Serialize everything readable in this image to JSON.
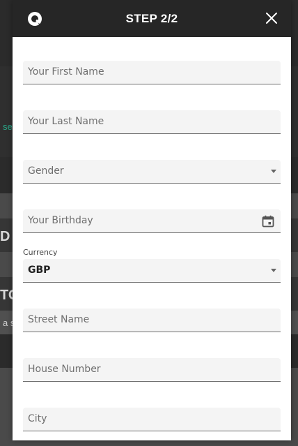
{
  "backdrop": {
    "link_text": "se",
    "heading_1": "D",
    "heading_2": "TO",
    "small_text": "a s"
  },
  "modal": {
    "title": "STEP 2/2",
    "brand_icon": "brand-logo-icon",
    "close_icon": "close-icon"
  },
  "form": {
    "first_name_placeholder": "Your First Name",
    "last_name_placeholder": "Your Last Name",
    "gender_placeholder": "Gender",
    "birthday_placeholder": "Your Birthday",
    "currency_label": "Currency",
    "currency_value": "GBP",
    "street_placeholder": "Street Name",
    "house_placeholder": "House Number",
    "city_placeholder": "City"
  },
  "colors": {
    "header_bg": "#262626",
    "field_bg": "#f4f4f4",
    "accent": "#2aa889"
  }
}
